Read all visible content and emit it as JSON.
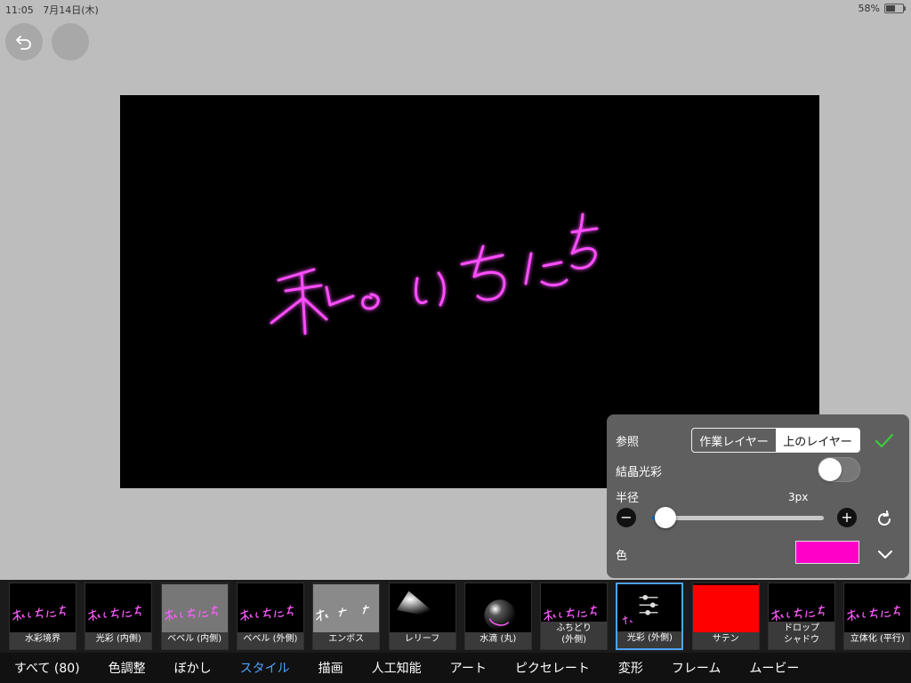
{
  "status": {
    "time": "11:05",
    "date": "7月14日(木)",
    "battery": "58%",
    "battery_fraction": 0.58
  },
  "canvas": {
    "background": "#000000",
    "stroke_color": "#ff4dff"
  },
  "panel": {
    "reference_label": "参照",
    "reference_options": [
      "作業レイヤー",
      "上のレイヤー"
    ],
    "reference_selected": 0,
    "crystal_glow_label": "結晶光彩",
    "crystal_glow_on": false,
    "radius_label": "半径",
    "radius_value": "3px",
    "radius_fraction": 0.08,
    "color_label": "色",
    "color_value": "#ff00c8"
  },
  "filters": [
    {
      "label": "水彩境界",
      "icon": "sample-text-thumb"
    },
    {
      "label": "光彩 (内側)",
      "icon": "sample-text-thumb"
    },
    {
      "label": "ベベル (内側)",
      "icon": "bevel-thumb"
    },
    {
      "label": "ベベル (外側)",
      "icon": "sample-text-thumb"
    },
    {
      "label": "エンボス",
      "icon": "emboss-thumb"
    },
    {
      "label": "レリーフ",
      "icon": "relief-thumb"
    },
    {
      "label": "水滴 (丸)",
      "icon": "droplet-thumb"
    },
    {
      "label": "ふちどり\n(外側)",
      "icon": "sample-text-thumb"
    },
    {
      "label": "光彩 (外側)",
      "icon": "sliders-thumb"
    },
    {
      "label": "サテン",
      "icon": "satin-thumb"
    },
    {
      "label": "ドロップ\nシャドウ",
      "icon": "sample-text-thumb"
    },
    {
      "label": "立体化 (平行)",
      "icon": "sample-text-thumb"
    }
  ],
  "selected_filter": 8,
  "tabs": [
    "すべて (80)",
    "色調整",
    "ぼかし",
    "スタイル",
    "描画",
    "人工知能",
    "アート",
    "ピクセレート",
    "変形",
    "フレーム",
    "ムービー"
  ],
  "active_tab": 3
}
